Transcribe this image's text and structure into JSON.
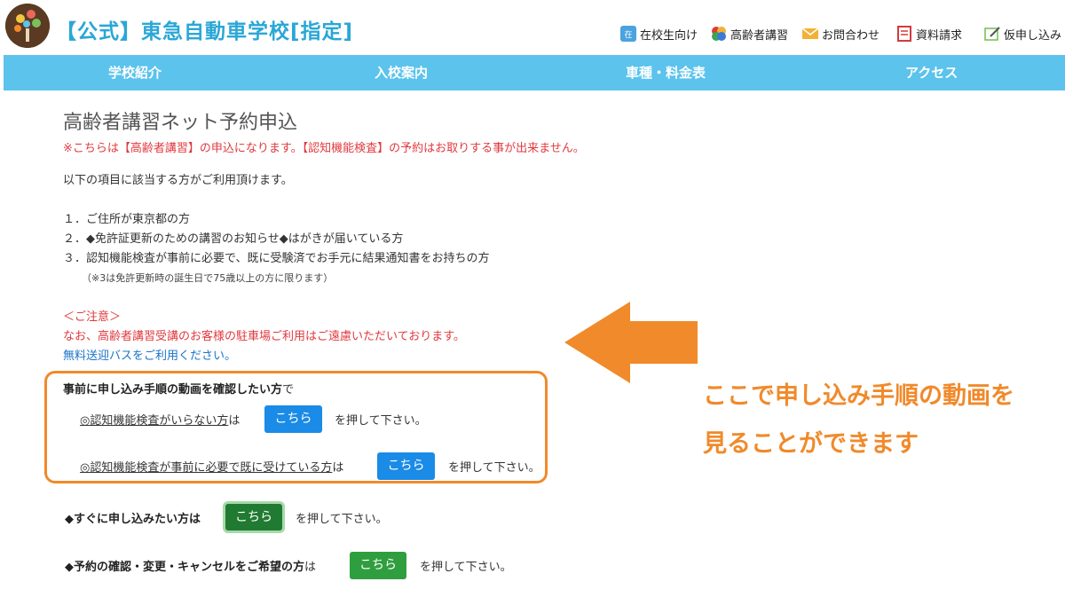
{
  "header": {
    "site_title": "【公式】東急自動車学校[指定]",
    "util_links": [
      {
        "label": "在校生向け",
        "icon": "student-icon",
        "color": "#4aa3df"
      },
      {
        "label": "高齢者講習",
        "icon": "senior-mark-icon",
        "color": "#e23b2e"
      },
      {
        "label": "お問合わせ",
        "icon": "mail-icon",
        "color": "#f2b135"
      },
      {
        "label": "資料請求",
        "icon": "document-icon",
        "color": "#d23b3b"
      },
      {
        "label": "仮申し込み",
        "icon": "pencil-icon",
        "color": "#6fbf4a"
      }
    ]
  },
  "nav": {
    "items": [
      "学校紹介",
      "入校案内",
      "車種・料金表",
      "アクセス"
    ],
    "bg_color": "#5bc3ec"
  },
  "main": {
    "title": "高齢者講習ネット予約申込",
    "notice": "※こちらは【高齢者講習】の申込になります。【認知機能検査】の予約はお取りする事が出来ません。",
    "intro": "以下の項目に該当する方がご利用頂けます。",
    "conditions": [
      "１．ご住所が東京都の方",
      "２．◆免許証更新のための講習のお知らせ◆はがきが届いている方",
      "３．認知機能検査が事前に必要で、既に受験済でお手元に結果通知書をお持ちの方"
    ],
    "condition_note": "（※3は免許更新時の誕生日で75歳以上の方に限ります）",
    "caution_heading": "＜ご注意＞",
    "caution_text": "なお、高齢者講習受講のお客様の駐車場ご利用はご遠慮いただいております。",
    "bus_link": "無料送迎バス",
    "bus_suffix": "をご利用ください。",
    "video_box": {
      "heading_bold": "事前に申し込み手順の動画を確認したい方",
      "heading_suffix": "で",
      "row1_label": "◎認知機能検査がいらない方",
      "row1_suffix": "は",
      "row2_label": "◎認知機能検査が事前に必要で既に受けている方",
      "row2_suffix": "は",
      "button_label": "こちら",
      "push_text": "を押して下さい。",
      "border_color": "#f08a2b"
    },
    "apply_now": {
      "label": "◆すぐに申し込みたい方は",
      "button_label": "こちら",
      "push_text": "を押して下さい。"
    },
    "manage": {
      "label_bold": "◆予約の確認・変更・キャンセルをご希望の方",
      "label_suffix": "は",
      "button_label": "こちら",
      "push_text": "を押して下さい。"
    }
  },
  "callout": {
    "line1": "ここで申し込み手順の動画を",
    "line2": "見ることができます",
    "color": "#f08a2b"
  }
}
